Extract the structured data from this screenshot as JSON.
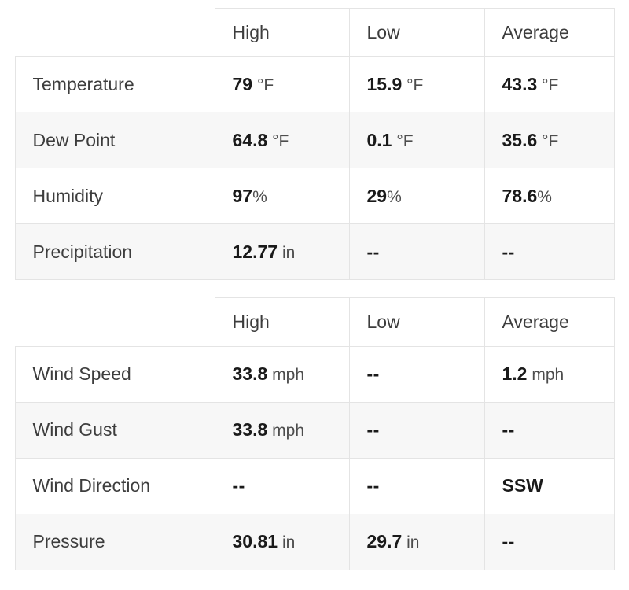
{
  "colors": {
    "border": "#e4e4e4",
    "stripe_background": "#f7f7f7",
    "plain_background": "#ffffff",
    "label_text": "#3d3d3d",
    "value_text": "#1a1a1a",
    "unit_text": "#4d4d4d"
  },
  "missing_placeholder": "--",
  "tables": [
    {
      "name": "atmospheric-summary",
      "corner_label": "",
      "columns": [
        "High",
        "Low",
        "Average"
      ],
      "rows": [
        {
          "label": "Temperature",
          "cells": [
            {
              "value": "79",
              "unit": "°F",
              "unit_spacing": "spaced",
              "missing": false
            },
            {
              "value": "15.9",
              "unit": "°F",
              "unit_spacing": "spaced",
              "missing": false
            },
            {
              "value": "43.3",
              "unit": "°F",
              "unit_spacing": "spaced",
              "missing": false
            }
          ]
        },
        {
          "label": "Dew Point",
          "cells": [
            {
              "value": "64.8",
              "unit": "°F",
              "unit_spacing": "spaced",
              "missing": false
            },
            {
              "value": "0.1",
              "unit": "°F",
              "unit_spacing": "spaced",
              "missing": false
            },
            {
              "value": "35.6",
              "unit": "°F",
              "unit_spacing": "spaced",
              "missing": false
            }
          ]
        },
        {
          "label": "Humidity",
          "cells": [
            {
              "value": "97",
              "unit": "%",
              "unit_spacing": "flush",
              "missing": false
            },
            {
              "value": "29",
              "unit": "%",
              "unit_spacing": "flush",
              "missing": false
            },
            {
              "value": "78.6",
              "unit": "%",
              "unit_spacing": "flush",
              "missing": false
            }
          ]
        },
        {
          "label": "Precipitation",
          "cells": [
            {
              "value": "12.77",
              "unit": "in",
              "unit_spacing": "spaced",
              "missing": false
            },
            {
              "value": "--",
              "unit": "",
              "unit_spacing": "flush",
              "missing": true
            },
            {
              "value": "--",
              "unit": "",
              "unit_spacing": "flush",
              "missing": true
            }
          ]
        }
      ]
    },
    {
      "name": "wind-and-pressure-summary",
      "corner_label": "",
      "columns": [
        "High",
        "Low",
        "Average"
      ],
      "rows": [
        {
          "label": "Wind Speed",
          "cells": [
            {
              "value": "33.8",
              "unit": "mph",
              "unit_spacing": "spaced",
              "missing": false
            },
            {
              "value": "--",
              "unit": "",
              "unit_spacing": "flush",
              "missing": true
            },
            {
              "value": "1.2",
              "unit": "mph",
              "unit_spacing": "spaced",
              "missing": false
            }
          ]
        },
        {
          "label": "Wind Gust",
          "cells": [
            {
              "value": "33.8",
              "unit": "mph",
              "unit_spacing": "spaced",
              "missing": false
            },
            {
              "value": "--",
              "unit": "",
              "unit_spacing": "flush",
              "missing": true
            },
            {
              "value": "--",
              "unit": "",
              "unit_spacing": "flush",
              "missing": true
            }
          ]
        },
        {
          "label": "Wind Direction",
          "cells": [
            {
              "value": "--",
              "unit": "",
              "unit_spacing": "flush",
              "missing": true
            },
            {
              "value": "--",
              "unit": "",
              "unit_spacing": "flush",
              "missing": true
            },
            {
              "value": "SSW",
              "unit": "",
              "unit_spacing": "flush",
              "missing": false
            }
          ]
        },
        {
          "label": "Pressure",
          "cells": [
            {
              "value": "30.81",
              "unit": "in",
              "unit_spacing": "spaced",
              "missing": false
            },
            {
              "value": "29.7",
              "unit": "in",
              "unit_spacing": "spaced",
              "missing": false
            },
            {
              "value": "--",
              "unit": "",
              "unit_spacing": "flush",
              "missing": true
            }
          ]
        }
      ]
    }
  ]
}
